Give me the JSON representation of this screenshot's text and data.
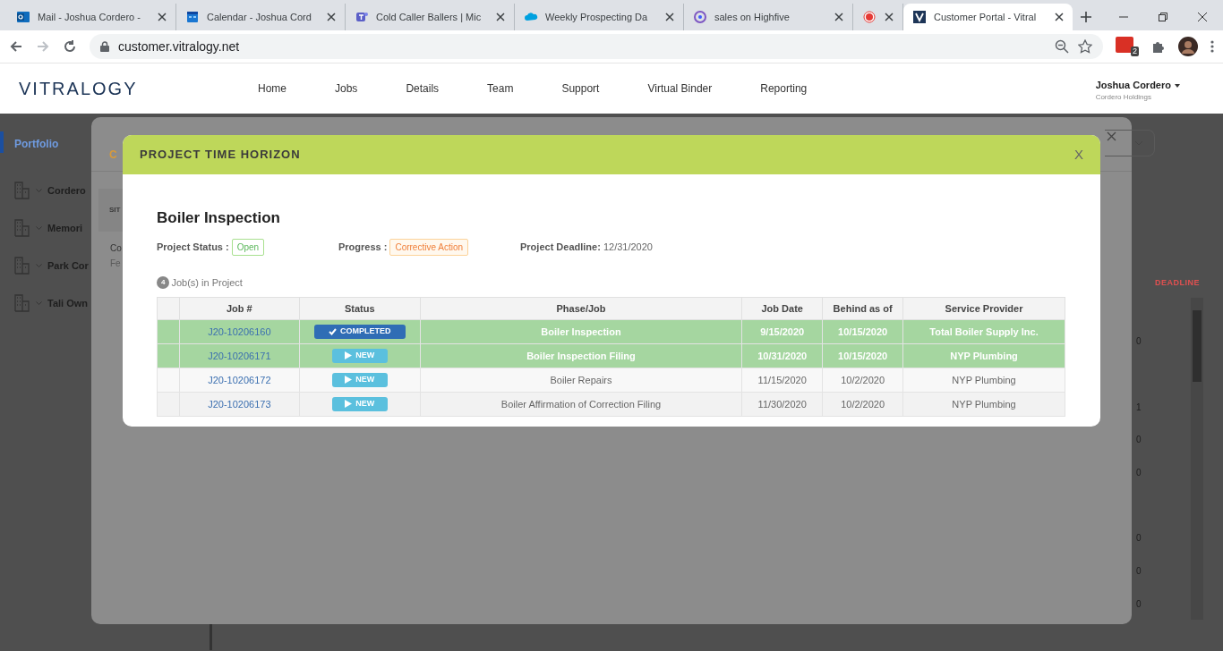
{
  "browser": {
    "tabs": [
      {
        "title": "Mail - Joshua Cordero -",
        "selected": false
      },
      {
        "title": "Calendar - Joshua Cord",
        "selected": false
      },
      {
        "title": "Cold Caller Ballers | Mic",
        "selected": false
      },
      {
        "title": "Weekly Prospecting Da",
        "selected": false
      },
      {
        "title": "sales on Highfive",
        "selected": false
      },
      {
        "selected": false
      },
      {
        "title": "Customer Portal - Vitral",
        "selected": true
      }
    ],
    "url": "customer.vitralogy.net",
    "extension_badge": "2"
  },
  "header": {
    "logo": "VITRALOGY",
    "nav": [
      "Home",
      "Jobs",
      "Details",
      "Team",
      "Support",
      "Virtual Binder",
      "Reporting"
    ],
    "user": "Joshua Cordero",
    "company": "Cordero Holdings"
  },
  "sidebar": {
    "title": "Portfolio",
    "items": [
      "Cordero",
      "Memori",
      "Park Cor",
      "Tali Own"
    ]
  },
  "background": {
    "column_heading": "DEADLINE",
    "values": [
      "0",
      "1",
      "0",
      "0",
      "0",
      "0",
      "0"
    ]
  },
  "outer_modal": {
    "subtitle": "C",
    "tab": "SIT",
    "row_title": "Co",
    "row_sub": "Fe"
  },
  "modal": {
    "title": "PROJECT TIME HORIZON",
    "close": "X",
    "heading": "Boiler Inspection",
    "status_label": "Project Status :",
    "status_value": "Open",
    "progress_label": "Progress :",
    "progress_value": "Corrective Action",
    "deadline_label": "Project Deadline:",
    "deadline_value": "12/31/2020",
    "job_count": "4",
    "job_count_label": "Job(s) in Project",
    "table": {
      "columns": [
        "",
        "Job #",
        "Status",
        "Phase/Job",
        "Job Date",
        "Behind as of",
        "Service Provider"
      ],
      "rows": [
        {
          "highlighted": true,
          "job": "J20-10206160",
          "status": {
            "kind": "completed",
            "label": "COMPLETED"
          },
          "phase": "Boiler Inspection",
          "job_date": "9/15/2020",
          "behind_as_of": "10/15/2020",
          "provider": "Total Boiler Supply Inc."
        },
        {
          "highlighted": true,
          "job": "J20-10206171",
          "status": {
            "kind": "new",
            "label": "NEW"
          },
          "phase": "Boiler Inspection Filing",
          "job_date": "10/31/2020",
          "behind_as_of": "10/15/2020",
          "provider": "NYP Plumbing"
        },
        {
          "highlighted": false,
          "job": "J20-10206172",
          "status": {
            "kind": "new",
            "label": "NEW"
          },
          "phase": "Boiler Repairs",
          "job_date": "11/15/2020",
          "behind_as_of": "10/2/2020",
          "provider": "NYP Plumbing"
        },
        {
          "highlighted": false,
          "job": "J20-10206173",
          "status": {
            "kind": "new",
            "label": "NEW"
          },
          "phase": "Boiler Affirmation of Correction Filing",
          "job_date": "11/30/2020",
          "behind_as_of": "10/2/2020",
          "provider": "NYP Plumbing"
        }
      ]
    }
  }
}
